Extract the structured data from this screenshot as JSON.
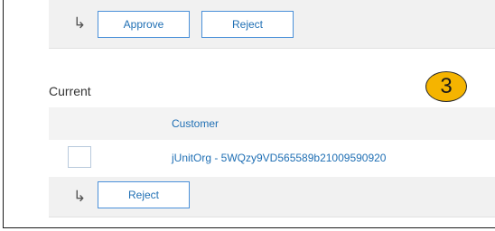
{
  "pending_actions": {
    "arrow_glyph": "↳",
    "approve_label": "Approve",
    "reject_label": "Reject"
  },
  "current_section": {
    "title": "Current",
    "columns": [
      "Customer"
    ],
    "rows": [
      {
        "customer": "jUnitOrg - 5WQzy9VD565589b21009590920",
        "checked": false
      }
    ],
    "actions": {
      "arrow_glyph": "↳",
      "reject_label": "Reject"
    }
  },
  "step_badge": {
    "number": "3",
    "color": "#f5b400"
  },
  "colors": {
    "link": "#1f6fb4",
    "button_border": "#4a90d9",
    "bar_background": "#f1f1f1"
  }
}
